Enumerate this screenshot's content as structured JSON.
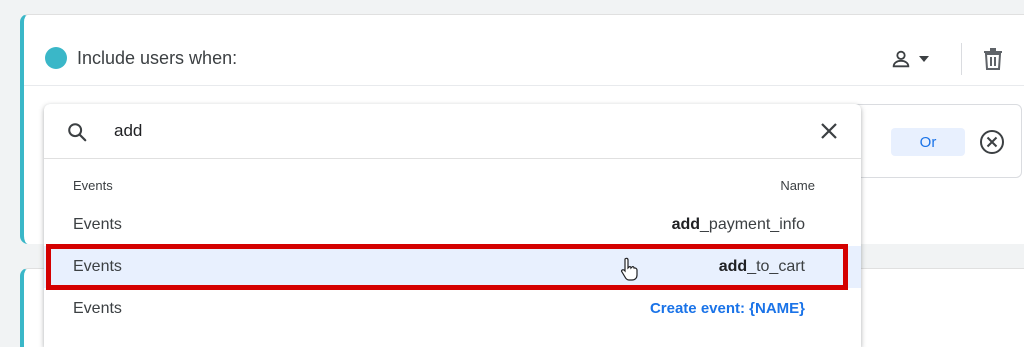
{
  "header": {
    "title": "Include users when:"
  },
  "condition": {
    "or_label": "Or"
  },
  "search": {
    "value": "add",
    "placeholder": ""
  },
  "columns": {
    "left": "Events",
    "right": "Name"
  },
  "rows": [
    {
      "category": "Events",
      "match": "add",
      "rest": "_payment_info"
    },
    {
      "category": "Events",
      "match": "add",
      "rest": "_to_cart"
    },
    {
      "category": "Events",
      "create_label": "Create event: {NAME}"
    }
  ],
  "colors": {
    "accent": "#3ab7c8",
    "link": "#1a73e8",
    "highlight_row": "#e8f0fe",
    "annotation": "#d40000"
  }
}
